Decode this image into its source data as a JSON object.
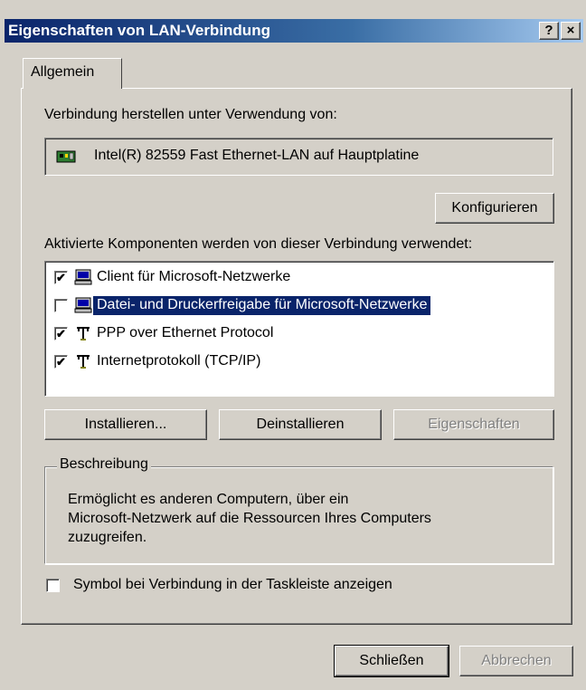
{
  "window": {
    "title": "Eigenschaften von LAN-Verbindung",
    "help_label": "?",
    "close_label": "×"
  },
  "tabs": [
    {
      "label": "Allgemein"
    }
  ],
  "connect_using": {
    "label": "Verbindung herstellen unter Verwendung von:",
    "adapter_name": "Intel(R) 82559 Fast Ethernet-LAN auf Hauptplatine",
    "adapter_icon": "network-card-icon"
  },
  "configure_label": "Konfigurieren",
  "components": {
    "label": "Aktivierte Komponenten werden von dieser Verbindung verwendet:",
    "items": [
      {
        "label": "Client für Microsoft-Netzwerke",
        "checked": true,
        "selected": false,
        "icon": "computer-icon"
      },
      {
        "label": "Datei- und Druckerfreigabe für Microsoft-Netzwerke",
        "checked": false,
        "selected": true,
        "icon": "computer-icon"
      },
      {
        "label": "PPP over Ethernet Protocol",
        "checked": true,
        "selected": false,
        "icon": "protocol-icon"
      },
      {
        "label": "Internetprotokoll (TCP/IP)",
        "checked": true,
        "selected": false,
        "icon": "protocol-icon"
      }
    ]
  },
  "buttons": {
    "install": "Installieren...",
    "uninstall": "Deinstallieren",
    "properties": "Eigenschaften",
    "close": "Schließen",
    "cancel": "Abbrechen"
  },
  "description": {
    "legend": "Beschreibung",
    "lines": [
      "Ermöglicht es anderen Computern, über ein",
      "Microsoft-Netzwerk auf die Ressourcen Ihres Computers",
      "zuzugreifen."
    ]
  },
  "taskbar_option": {
    "label": "Symbol bei Verbindung in der Taskleiste anzeigen",
    "checked": false
  },
  "colors": {
    "titlebar": "#0a246a",
    "face": "#d4d0c8",
    "selection": "#0a246a"
  }
}
